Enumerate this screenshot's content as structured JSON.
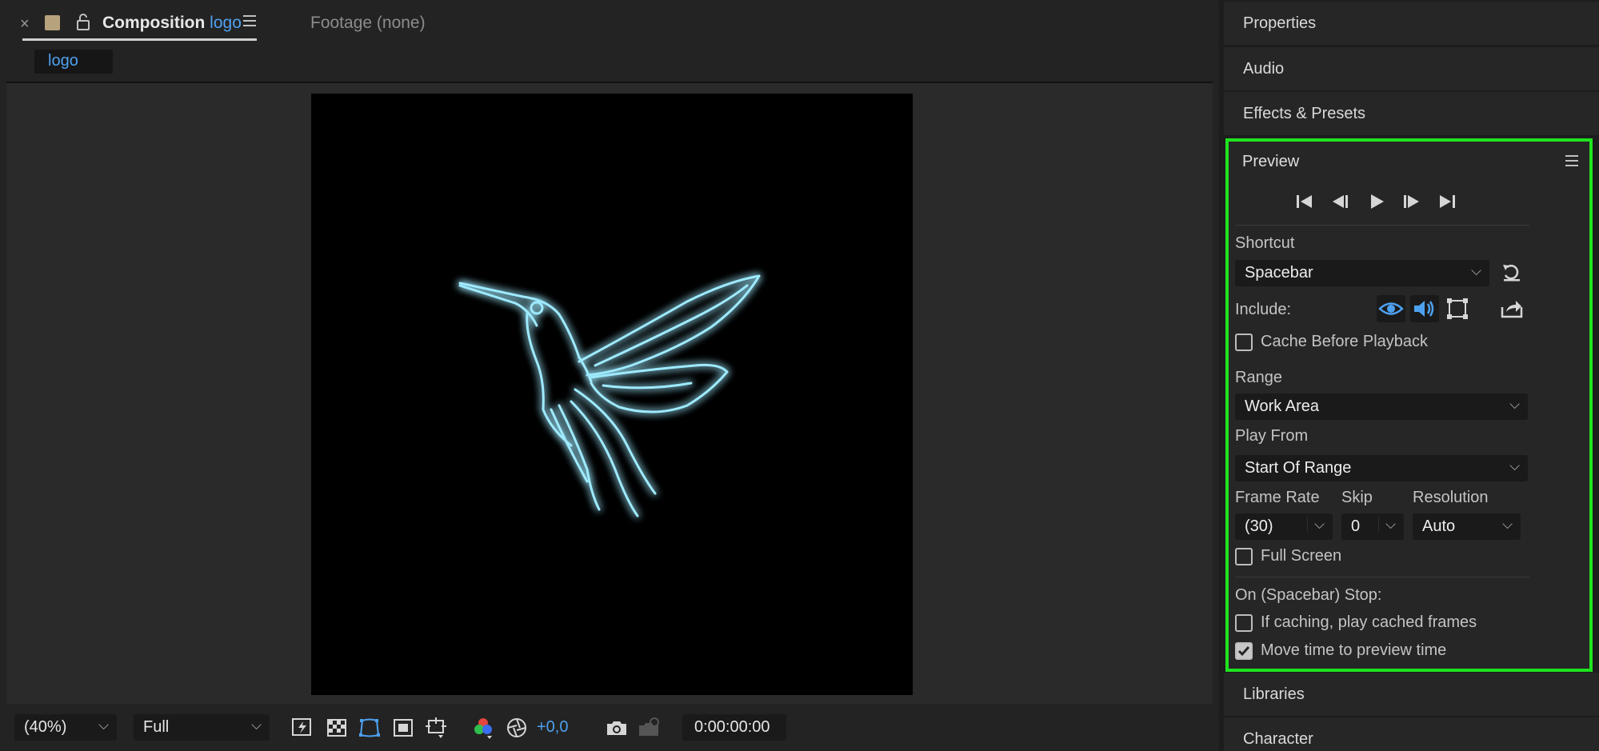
{
  "composition": {
    "tab_close": "×",
    "tab_title_prefix": "Composition",
    "tab_comp_name": "logo",
    "footage_tab": "Footage (none)",
    "breadcrumb": "logo"
  },
  "toolbar": {
    "zoom": "(40%)",
    "resolution": "Full",
    "exposure": "+0,0",
    "timecode": "0:00:00:00"
  },
  "panels": {
    "properties": "Properties",
    "audio": "Audio",
    "effects": "Effects & Presets",
    "libraries": "Libraries",
    "character": "Character"
  },
  "preview": {
    "title": "Preview",
    "shortcut_label": "Shortcut",
    "shortcut_value": "Spacebar",
    "include_label": "Include:",
    "cache_label": "Cache Before Playback",
    "cache_checked": false,
    "range_label": "Range",
    "range_value": "Work Area",
    "play_from_label": "Play From",
    "play_from_value": "Start Of Range",
    "frame_rate_label": "Frame Rate",
    "frame_rate_value": "(30)",
    "skip_label": "Skip",
    "skip_value": "0",
    "resolution_label": "Resolution",
    "resolution_value": "Auto",
    "full_screen_label": "Full Screen",
    "full_screen_checked": false,
    "stop_label": "On (Spacebar) Stop:",
    "play_cached_label": "If caching, play cached frames",
    "play_cached_checked": false,
    "move_time_label": "Move time to preview time",
    "move_time_checked": true
  },
  "colors": {
    "accent_blue": "#4ea1f0",
    "highlight_green": "#1fe31f",
    "glow": "#3fd0ff"
  }
}
